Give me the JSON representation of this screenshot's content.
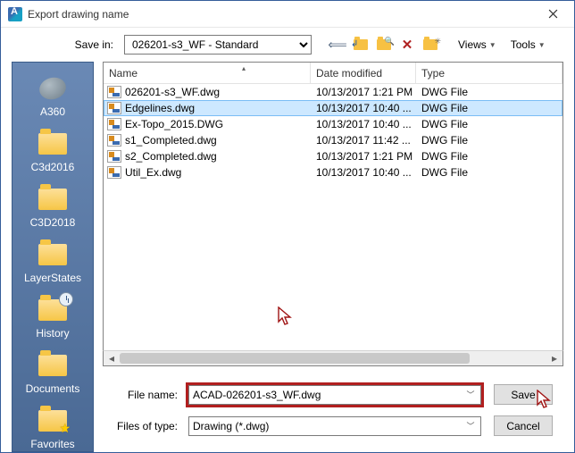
{
  "window": {
    "title": "Export drawing name"
  },
  "toolbar": {
    "save_in_label": "Save in:",
    "location": "026201-s3_WF - Standard",
    "views": "Views",
    "tools": "Tools"
  },
  "columns": {
    "name": "Name",
    "date": "Date modified",
    "type": "Type"
  },
  "sidebar": [
    {
      "label": "A360",
      "icon": "a360"
    },
    {
      "label": "C3d2016",
      "icon": "folder"
    },
    {
      "label": "C3D2018",
      "icon": "folder"
    },
    {
      "label": "LayerStates",
      "icon": "folder"
    },
    {
      "label": "History",
      "icon": "history"
    },
    {
      "label": "Documents",
      "icon": "folder"
    },
    {
      "label": "Favorites",
      "icon": "favorites"
    }
  ],
  "files": [
    {
      "name": "026201-s3_WF.dwg",
      "date": "10/13/2017 1:21 PM",
      "type": "DWG File",
      "selected": false
    },
    {
      "name": "Edgelines.dwg",
      "date": "10/13/2017 10:40 ...",
      "type": "DWG File",
      "selected": true
    },
    {
      "name": "Ex-Topo_2015.DWG",
      "date": "10/13/2017 10:40 ...",
      "type": "DWG File",
      "selected": false
    },
    {
      "name": "s1_Completed.dwg",
      "date": "10/13/2017 11:42 ...",
      "type": "DWG File",
      "selected": false
    },
    {
      "name": "s2_Completed.dwg",
      "date": "10/13/2017 1:21 PM",
      "type": "DWG File",
      "selected": false
    },
    {
      "name": "Util_Ex.dwg",
      "date": "10/13/2017 10:40 ...",
      "type": "DWG File",
      "selected": false
    }
  ],
  "bottom": {
    "file_name_label": "File name:",
    "file_name_value": "ACAD-026201-s3_WF.dwg",
    "files_of_type_label": "Files of type:",
    "files_of_type_value": "Drawing (*.dwg)",
    "save": "Save",
    "cancel": "Cancel"
  }
}
